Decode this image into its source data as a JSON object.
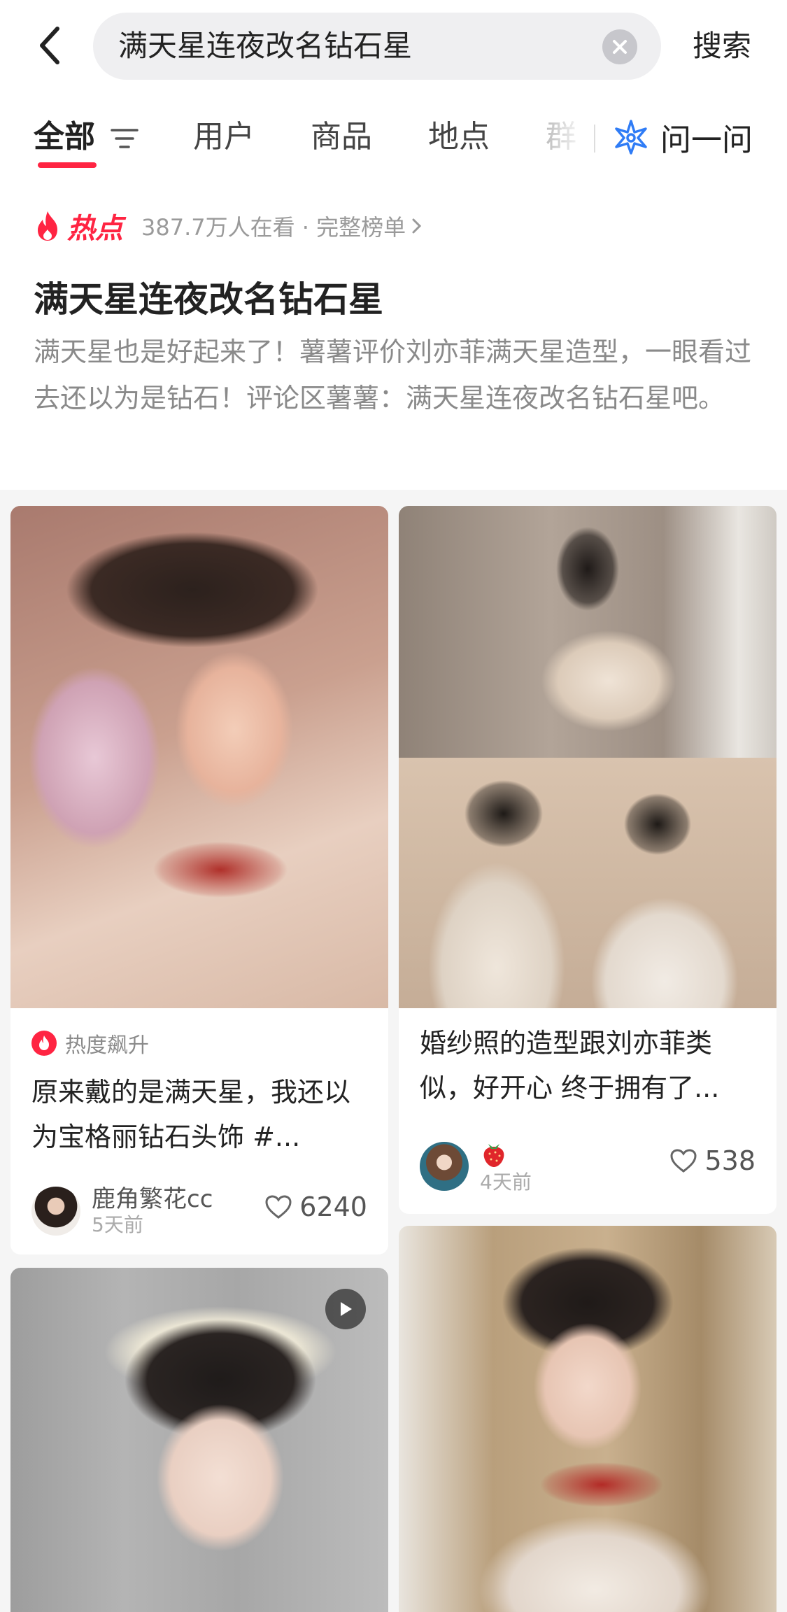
{
  "search": {
    "query": "满天星连夜改名钻石星",
    "submit_label": "搜索"
  },
  "tabs": [
    {
      "label": "全部"
    },
    {
      "label": "用户"
    },
    {
      "label": "商品"
    },
    {
      "label": "地点"
    },
    {
      "label": "群"
    }
  ],
  "ask": {
    "label": "问一问"
  },
  "hot": {
    "tag": "热点",
    "meta": "387.7万人在看 · 完整榜单",
    "title": "满天星连夜改名钻石星",
    "description": "满天星也是好起来了！薯薯评价刘亦菲满天星造型，一眼看过去还以为是钻石！评论区薯薯：满天星连夜改名钻石星吧。"
  },
  "cards": [
    {
      "trend": "热度飙升",
      "title": "原来戴的是满天星，我还以为宝格丽钻石头饰 #...",
      "author": "鹿角繁花cc",
      "time": "5天前",
      "likes": "6240"
    },
    {
      "title": "婚纱照的造型跟刘亦菲类似，好开心 终于拥有了...",
      "author_icon": "strawberry-icon",
      "time": "4天前",
      "likes": "538"
    }
  ],
  "colors": {
    "accent": "#ff2442",
    "ask_icon": "#2f7cf6"
  }
}
